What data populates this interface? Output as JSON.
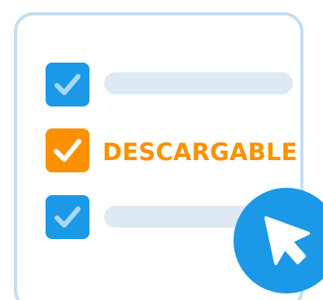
{
  "colors": {
    "card_border": "#c4def2",
    "checkbox_blue": "#1b99e6",
    "checkbox_blue_check": "#a9d7f3",
    "checkbox_orange": "#fb9100",
    "check_white": "#ffffff",
    "bar_gray": "#dde9f3",
    "label_orange": "#fb9100",
    "cursor_badge": "#1b99e6",
    "cursor_arrow": "#ffffff"
  },
  "icons": {
    "checkbox_blue": "checkbox-checked-icon",
    "checkbox_orange": "checkbox-checked-icon",
    "cursor": "mouse-pointer-icon"
  },
  "items": [
    {
      "checked": true,
      "highlighted": false,
      "label": ""
    },
    {
      "checked": true,
      "highlighted": true,
      "label": "DESCARGABLE"
    },
    {
      "checked": true,
      "highlighted": false,
      "label": ""
    }
  ]
}
